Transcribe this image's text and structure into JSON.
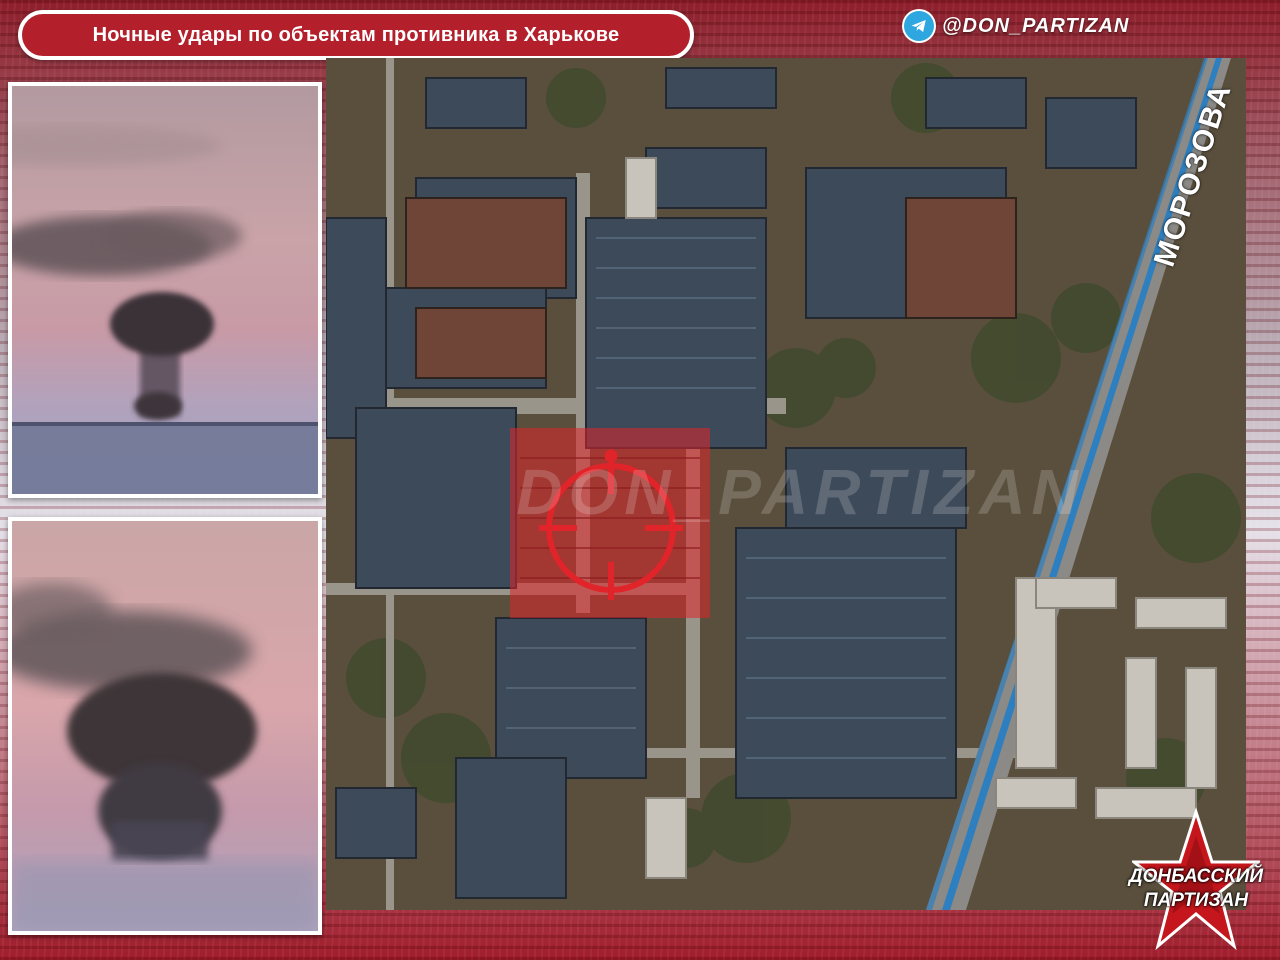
{
  "header": {
    "title": "Ночные удары по объектам противника в Харькове",
    "telegram_icon": "telegram-icon",
    "handle": "@DON_PARTIZAN"
  },
  "map": {
    "street_label": "МОРОЗОВА",
    "watermark": "DON_PARTIZAN",
    "target_color": "#e0242a",
    "target_icon": "crosshair-icon"
  },
  "logo": {
    "icon": "star-icon",
    "line1": "ДОНБАССКИЙ",
    "line2": "ПАРТИЗАН",
    "color": "#c4161c"
  },
  "colors": {
    "accent": "#b3202c",
    "telegram": "#2ea6e0"
  }
}
